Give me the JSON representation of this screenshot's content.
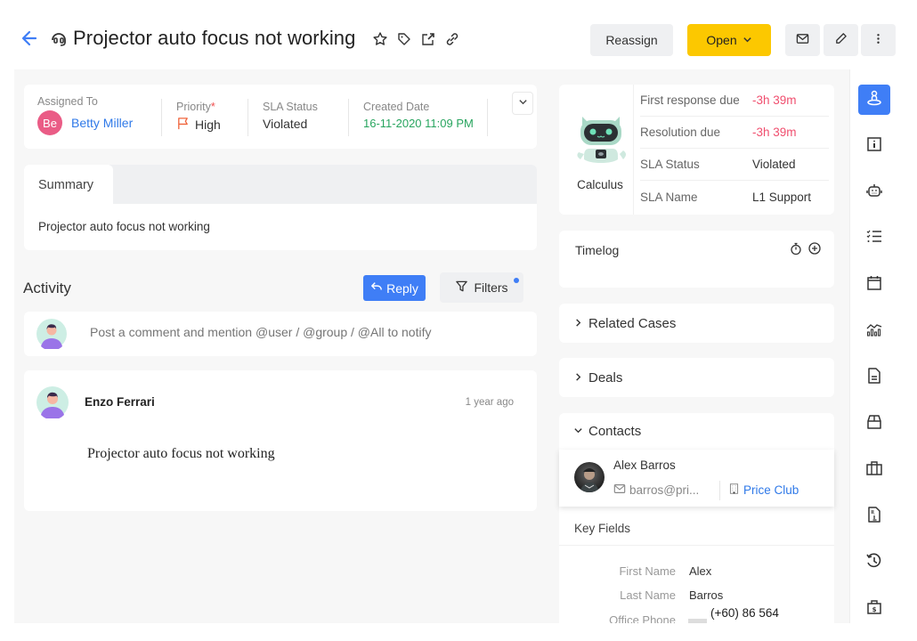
{
  "header": {
    "title": "Projector auto focus not working",
    "reassign_label": "Reassign",
    "status_label": "Open",
    "accent_color": "#3f7ef6",
    "status_color": "#fcc800"
  },
  "info": {
    "assigned_label": "Assigned To",
    "assigned_initials": "Be",
    "assigned_name": "Betty Miller",
    "priority_label": "Priority",
    "priority_required": "*",
    "priority_value": "High",
    "sla_label": "SLA Status",
    "sla_value": "Violated",
    "created_label": "Created Date",
    "created_value": "16-11-2020 11:09 PM"
  },
  "summary": {
    "tab_label": "Summary",
    "text": "Projector auto focus not working"
  },
  "activity": {
    "title": "Activity",
    "reply_label": "Reply",
    "filters_label": "Filters",
    "comment_placeholder": "Post a comment and mention @user / @group / @All to notify",
    "posts": [
      {
        "author": "Enzo Ferrari",
        "time": "1 year ago",
        "body": "Projector auto focus not working"
      }
    ]
  },
  "sla": {
    "bot_name": "Calculus",
    "rows": [
      {
        "key": "First response due",
        "value": "-3h 39m",
        "overdue": true
      },
      {
        "key": "Resolution due",
        "value": "-3h 39m",
        "overdue": true
      },
      {
        "key": "SLA Status",
        "value": "Violated",
        "overdue": false
      },
      {
        "key": "SLA Name",
        "value": "L1 Support",
        "overdue": false
      }
    ]
  },
  "timelog": {
    "title": "Timelog"
  },
  "related_cases": {
    "title": "Related Cases"
  },
  "deals": {
    "title": "Deals"
  },
  "contacts": {
    "title": "Contacts",
    "items": [
      {
        "name": "Alex Barros",
        "email": "barros@pri...",
        "company": "Price Club"
      }
    ],
    "key_fields_title": "Key Fields",
    "key_fields": [
      {
        "label": "First Name",
        "value": "Alex"
      },
      {
        "label": "Last Name",
        "value": "Barros"
      },
      {
        "label": "Office Phone",
        "value": "(+60) 86 564"
      }
    ]
  },
  "rightbar": {
    "items": [
      {
        "icon": "person-location-icon",
        "active": true
      },
      {
        "icon": "info-icon",
        "active": false
      },
      {
        "icon": "robot-icon",
        "active": false
      },
      {
        "icon": "checklist-icon",
        "active": false
      },
      {
        "icon": "calendar-icon",
        "active": false
      },
      {
        "icon": "analytics-icon",
        "active": false
      },
      {
        "icon": "document-icon",
        "active": false
      },
      {
        "icon": "box-icon",
        "active": false
      },
      {
        "icon": "briefcase-icon",
        "active": false
      },
      {
        "icon": "file-info-icon",
        "active": false
      },
      {
        "icon": "history-icon",
        "active": false
      },
      {
        "icon": "money-bag-icon",
        "active": false
      }
    ]
  }
}
